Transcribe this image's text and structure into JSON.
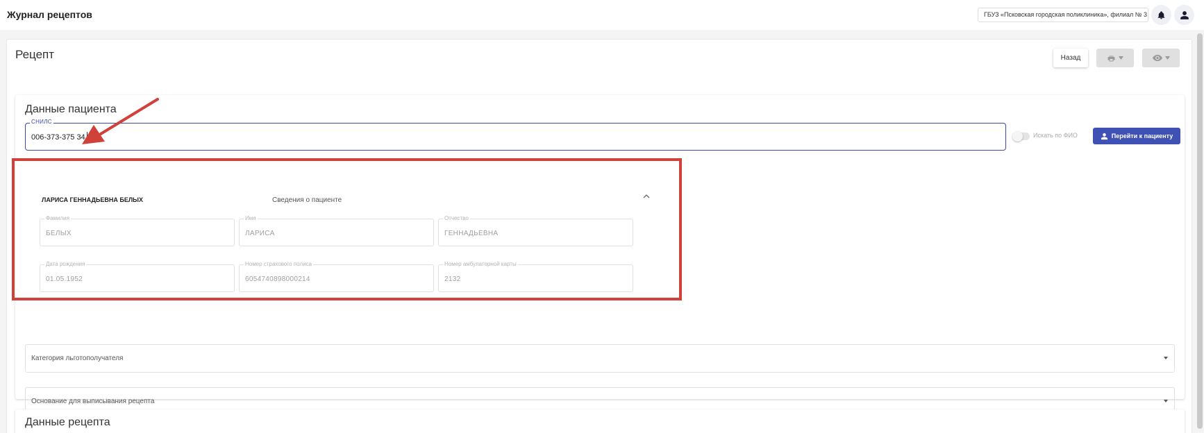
{
  "header": {
    "title": "Журнал рецептов",
    "organization": "ГБУЗ «Псковская городская поликлиника», филиал № 3"
  },
  "recipe": {
    "title": "Рецепт",
    "back_label": "Назад"
  },
  "patient": {
    "section_title": "Данные пациента",
    "snils_label": "СНИЛС",
    "snils_value": "006-373-375 34",
    "search_by_name_label": "Искать по ФИО",
    "go_to_patient_label": "Перейти к пациенту",
    "full_name": "ЛАРИСА ГЕННАДЬЕВНА БЕЛЫХ",
    "details_title": "Сведения о пациенте",
    "fields": [
      {
        "label": "Фамилия",
        "value": "БЕЛЫХ"
      },
      {
        "label": "Имя",
        "value": "ЛАРИСА"
      },
      {
        "label": "Отчество",
        "value": "ГЕННАДЬЕВНА"
      },
      {
        "label": "Дата рождения",
        "value": "01.05.1952"
      },
      {
        "label": "Номер страхового полиса",
        "value": "6054740898000214"
      },
      {
        "label": "Номер амбулаторной карты",
        "value": "2132"
      }
    ],
    "benefit_category": "Категория льготополучателя",
    "prescription_reason": "Основание для выписывания рецепта"
  },
  "prescription": {
    "section_title": "Данные рецепта"
  },
  "colors": {
    "accent": "#3f51b5",
    "annotation": "#d0413a"
  },
  "icons": [
    "bell-icon",
    "user-icon",
    "printer-icon",
    "eye-icon",
    "chevron-down-icon",
    "chevron-up-icon",
    "person-icon"
  ]
}
